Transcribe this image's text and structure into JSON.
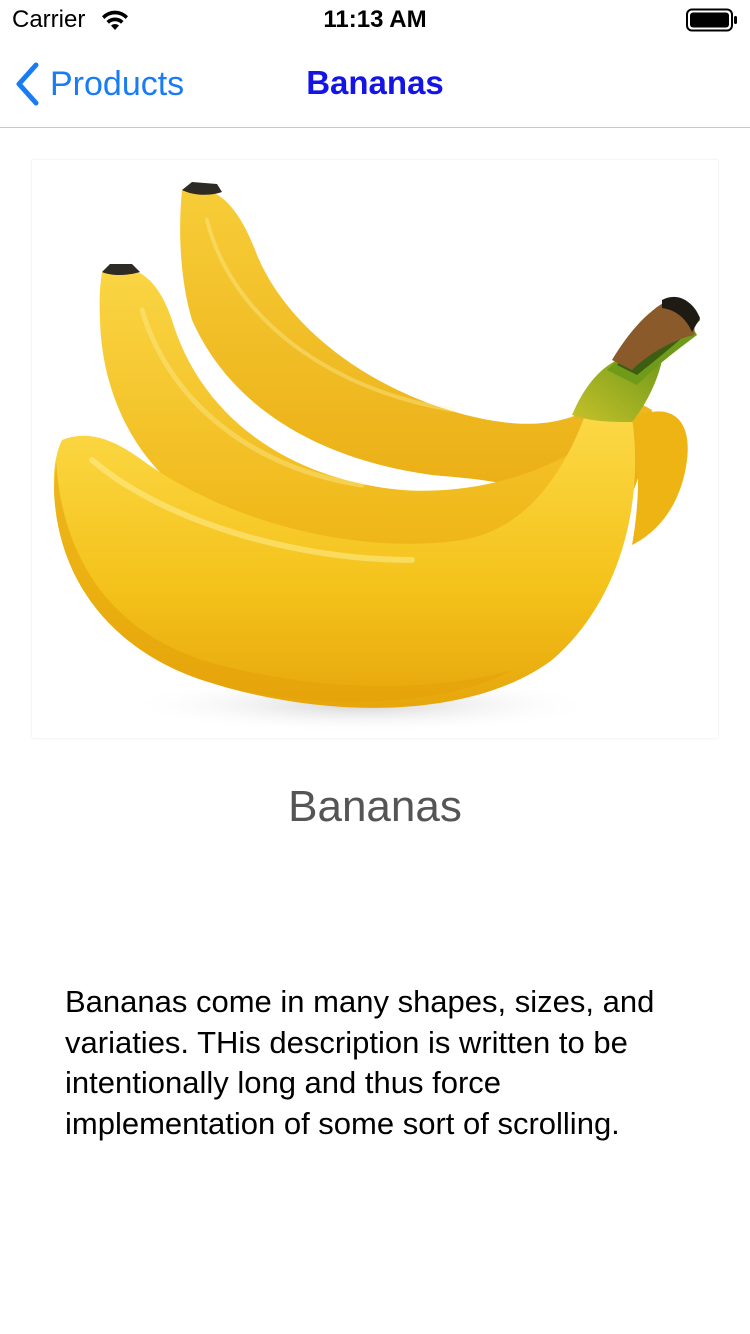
{
  "status_bar": {
    "carrier": "Carrier",
    "time": "11:13 AM",
    "wifi_icon": "wifi-icon",
    "battery_icon": "battery-icon"
  },
  "nav_bar": {
    "back_label": "Products",
    "back_icon": "chevron-left-icon",
    "title": "Bananas",
    "back_color": "#1a7cf5",
    "title_color": "#1414e6"
  },
  "product": {
    "image_subject": "bananas",
    "name": "Bananas",
    "description": "Bananas come in many shapes, sizes, and variaties. THis description is written to be intentionally long and thus force implementation of some sort of scrolling."
  },
  "colors": {
    "banana_yellow": "#f4c21a",
    "banana_shadow": "#e0a810",
    "stem_green": "#7fa51e",
    "divider": "#c8c7cc"
  }
}
